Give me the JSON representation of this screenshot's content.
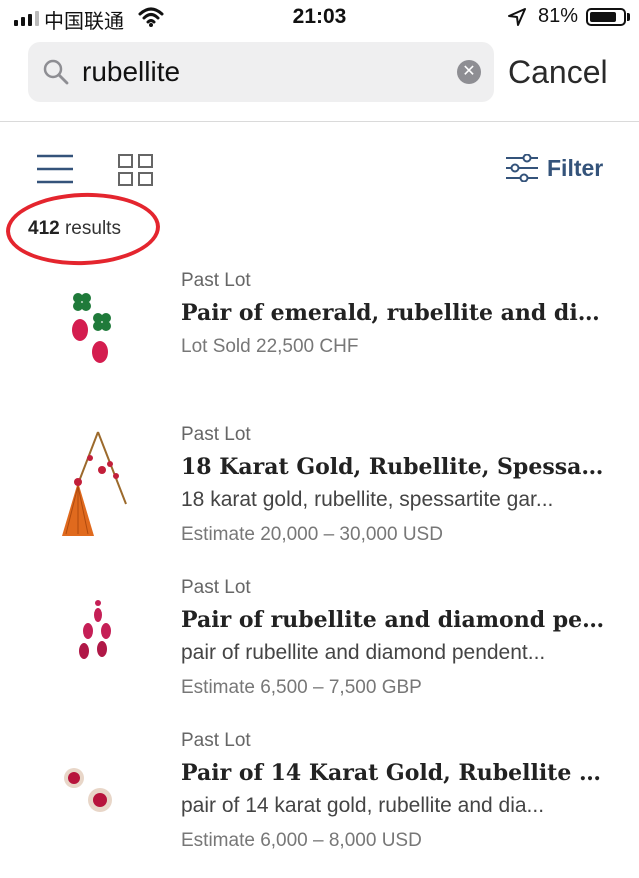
{
  "status_bar": {
    "carrier": "中国联通",
    "time": "21:03",
    "battery": "81%",
    "battery_level": 0.81
  },
  "search": {
    "value": "rubellite",
    "cancel_label": "Cancel"
  },
  "toolbar": {
    "filter_label": "Filter",
    "results_count": "412",
    "results_label": "results"
  },
  "annotation_color": "#e4252e",
  "results": [
    {
      "kind": "Past Lot",
      "title": "Pair of emerald, rubellite and diam...",
      "description": "",
      "meta": "Lot Sold 22,500 CHF",
      "thumbnail_icon": "emerald-rubellite-earrings-icon"
    },
    {
      "kind": "Past Lot",
      "title": "18 Karat Gold, Rubellite, Spessartit...",
      "description": "18 karat gold, rubellite, spessartite gar...",
      "meta": "Estimate 20,000 – 30,000 USD",
      "thumbnail_icon": "tassel-necklace-icon"
    },
    {
      "kind": "Past Lot",
      "title": "Pair of rubellite and diamond pend...",
      "description": "pair of rubellite and diamond pendent...",
      "meta": "Estimate 6,500 – 7,500 GBP",
      "thumbnail_icon": "pendant-earrings-icon"
    },
    {
      "kind": "Past Lot",
      "title": "Pair of 14 Karat Gold, Rubellite and...",
      "description": "pair of 14 karat gold, rubellite and dia...",
      "meta": "Estimate 6,000 – 8,000 USD",
      "thumbnail_icon": "cluster-earrings-icon"
    }
  ]
}
